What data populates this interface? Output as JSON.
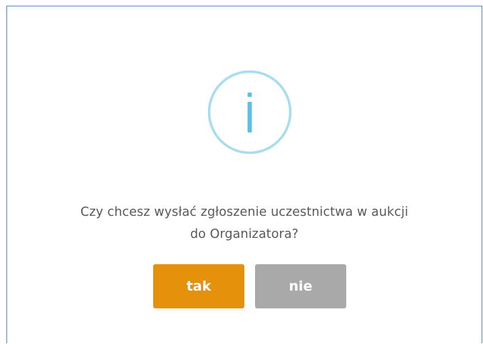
{
  "dialog": {
    "icon": "info-icon",
    "message_line1": "Czy chcesz wysłać zgłoszenie uczestnictwa w aukcji",
    "message_line2": "do Organizatora?",
    "confirm_label": "tak",
    "cancel_label": "nie"
  },
  "colors": {
    "frame_border": "#5b86c8",
    "icon_ring": "#a8dcef",
    "icon_glyph": "#5bc0e6",
    "confirm_button": "#e5910c",
    "cancel_button": "#a9a9a9",
    "message_text": "#595959"
  }
}
